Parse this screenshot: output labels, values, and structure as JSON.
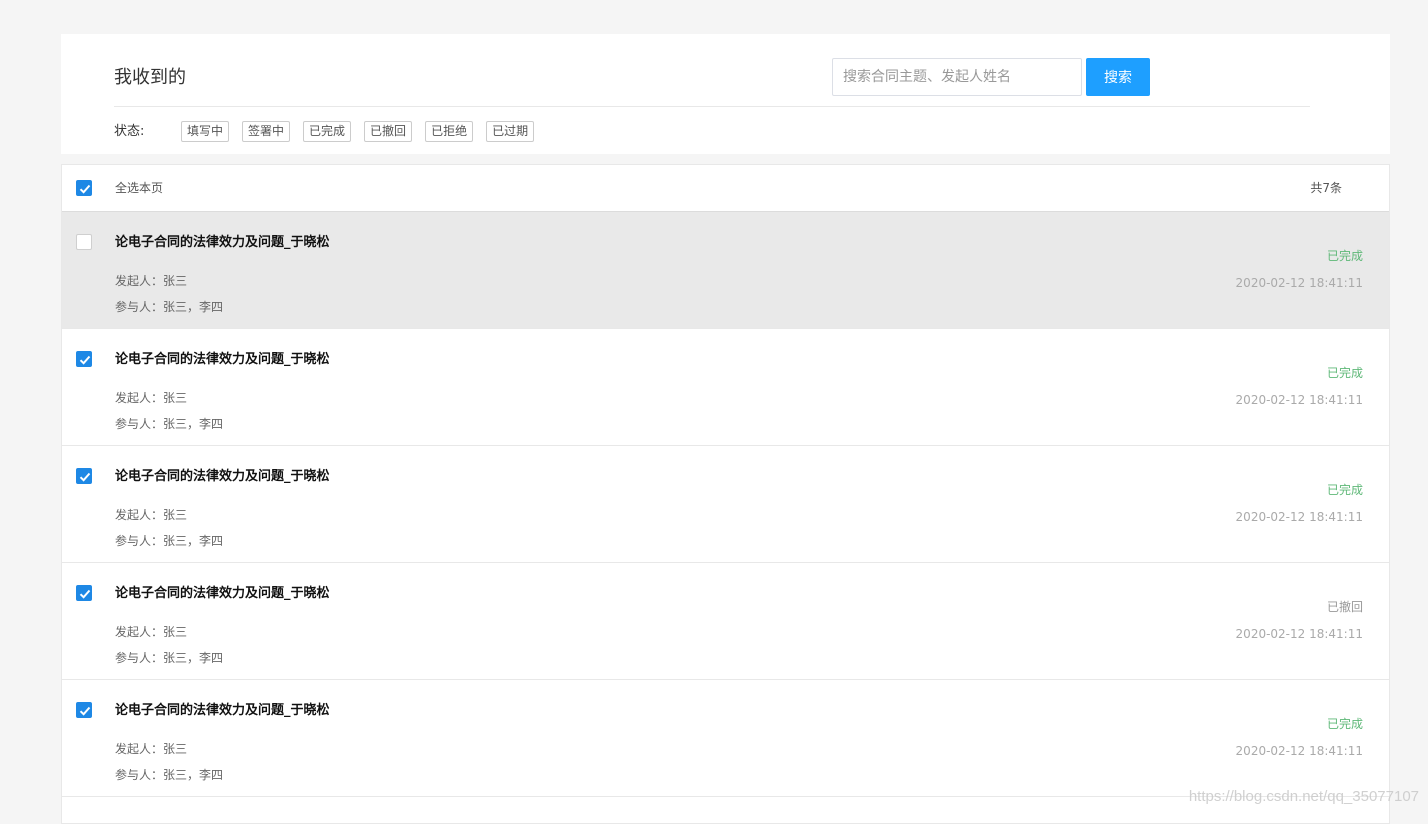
{
  "header": {
    "title": "我收到的",
    "search_placeholder": "搜索合同主题、发起人姓名",
    "search_button": "搜索",
    "status_label": "状态:",
    "status_filters": [
      "填写中",
      "签署中",
      "已完成",
      "已撤回",
      "已拒绝",
      "已过期"
    ]
  },
  "list": {
    "select_all_label": "全选本页",
    "select_all_checked": true,
    "total_text": "共7条",
    "rows": [
      {
        "checked": false,
        "title": "论电子合同的法律效力及问题_于晓松",
        "initiator": "发起人：张三",
        "participants": "参与人：张三，李四",
        "status": "已完成",
        "status_kind": "done",
        "time": "2020-02-12 18:41:11"
      },
      {
        "checked": true,
        "title": "论电子合同的法律效力及问题_于晓松",
        "initiator": "发起人：张三",
        "participants": "参与人：张三，李四",
        "status": "已完成",
        "status_kind": "done",
        "time": "2020-02-12 18:41:11"
      },
      {
        "checked": true,
        "title": "论电子合同的法律效力及问题_于晓松",
        "initiator": "发起人：张三",
        "participants": "参与人：张三，李四",
        "status": "已完成",
        "status_kind": "done",
        "time": "2020-02-12 18:41:11"
      },
      {
        "checked": true,
        "title": "论电子合同的法律效力及问题_于晓松",
        "initiator": "发起人：张三",
        "participants": "参与人：张三，李四",
        "status": "已撤回",
        "status_kind": "revoked",
        "time": "2020-02-12 18:41:11"
      },
      {
        "checked": true,
        "title": "论电子合同的法律效力及问题_于晓松",
        "initiator": "发起人：张三",
        "participants": "参与人：张三，李四",
        "status": "已完成",
        "status_kind": "done",
        "time": "2020-02-12 18:41:11"
      }
    ]
  },
  "colors": {
    "primary": "#1e9fff",
    "checkbox": "#1e88e5",
    "status_done": "#5fb878",
    "status_revoked": "#999999",
    "highlight_row": "#e9e9e9"
  },
  "watermark": "https://blog.csdn.net/qq_35077107"
}
